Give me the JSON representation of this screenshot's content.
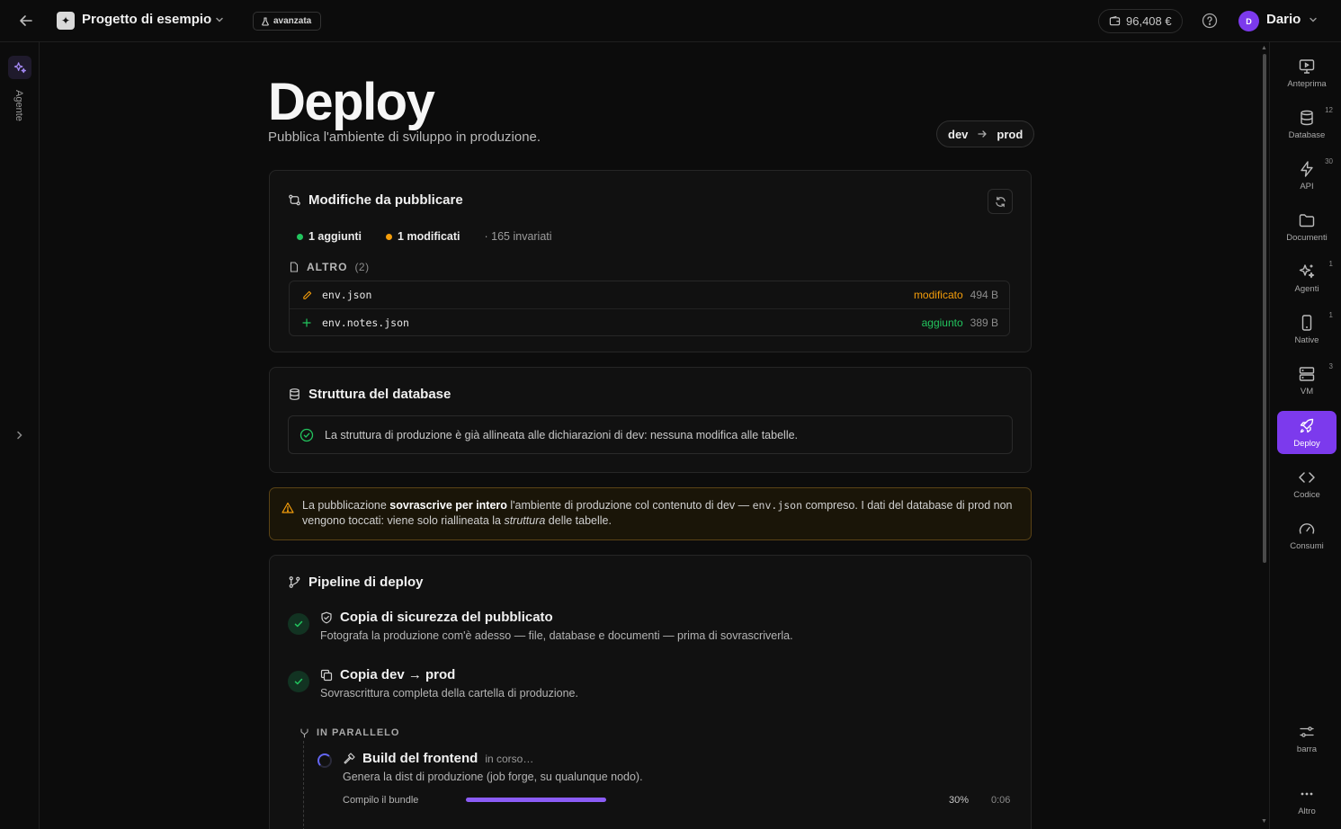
{
  "header": {
    "project_name": "Progetto di esempio",
    "mode_badge": "avanzata",
    "balance": "96,408 €",
    "user_initial": "D",
    "user_name": "Dario"
  },
  "left_rail": {
    "agent_label": "Agente"
  },
  "right_rail": {
    "items": [
      {
        "label": "Anteprima",
        "icon": "monitor-icon",
        "count": ""
      },
      {
        "label": "Database",
        "icon": "database-icon",
        "count": "12"
      },
      {
        "label": "API",
        "icon": "lightning-icon",
        "count": "30"
      },
      {
        "label": "Documenti",
        "icon": "folder-icon",
        "count": ""
      },
      {
        "label": "Agenti",
        "icon": "sparkles-icon",
        "count": "1"
      },
      {
        "label": "Native",
        "icon": "phone-icon",
        "count": "1"
      },
      {
        "label": "VM",
        "icon": "server-icon",
        "count": "3"
      },
      {
        "label": "Deploy",
        "icon": "rocket-icon",
        "count": ""
      },
      {
        "label": "Codice",
        "icon": "code-icon",
        "count": ""
      },
      {
        "label": "Consumi",
        "icon": "gauge-icon",
        "count": ""
      }
    ],
    "active": "Deploy",
    "bottom": [
      {
        "label": "barra",
        "icon": "sliders-icon"
      },
      {
        "label": "Altro",
        "icon": "more-icon"
      }
    ]
  },
  "page": {
    "title": "Deploy",
    "subtitle": "Pubblica l'ambiente di sviluppo in produzione.",
    "env_from": "dev",
    "env_to": "prod"
  },
  "changes": {
    "title": "Modifiche da pubblicare",
    "added": "1 aggiunti",
    "modified": "1 modificati",
    "unchanged": "· 165 invariati",
    "group_label": "ALTRO",
    "group_count": "(2)",
    "files": [
      {
        "name": "env.json",
        "status": "modificato",
        "size": "494 B",
        "kind": "modified"
      },
      {
        "name": "env.notes.json",
        "status": "aggiunto",
        "size": "389 B",
        "kind": "added"
      }
    ]
  },
  "db_structure": {
    "title": "Struttura del database",
    "message": "La struttura di produzione è già allineata alle dichiarazioni di dev: nessuna modifica alle tabelle."
  },
  "warning": {
    "p1": "La pubblicazione ",
    "b1": "sovrascrive per intero",
    "p2": " l'ambiente di produzione col contenuto di dev — ",
    "code": "env.json",
    "p3": " compreso. I dati del database di prod non vengono toccati: viene solo riallineata la ",
    "i1": "struttura",
    "p4": " delle tabelle."
  },
  "pipeline": {
    "title": "Pipeline di deploy",
    "steps": [
      {
        "title": "Copia di sicurezza del pubblicato",
        "desc": "Fotografa la produzione com'è adesso — file, database e documenti — prima di sovrascriverla."
      },
      {
        "title": "Copia dev → prod",
        "desc": "Sovrascrittura completa della cartella di produzione."
      }
    ],
    "parallel_label": "IN PARALLELO",
    "build": {
      "title": "Build del frontend",
      "status": "in corso…",
      "desc": "Genera la dist di produzione (job forge, su qualunque nodo).",
      "sub_label": "Compilo il bundle",
      "progress_pct": 30,
      "progress_text": "30%",
      "elapsed": "0:06"
    }
  },
  "colors": {
    "accent": "#7c3aed",
    "added": "#22c55e",
    "modified": "#f59e0b",
    "progress": "#8b5cf6"
  }
}
